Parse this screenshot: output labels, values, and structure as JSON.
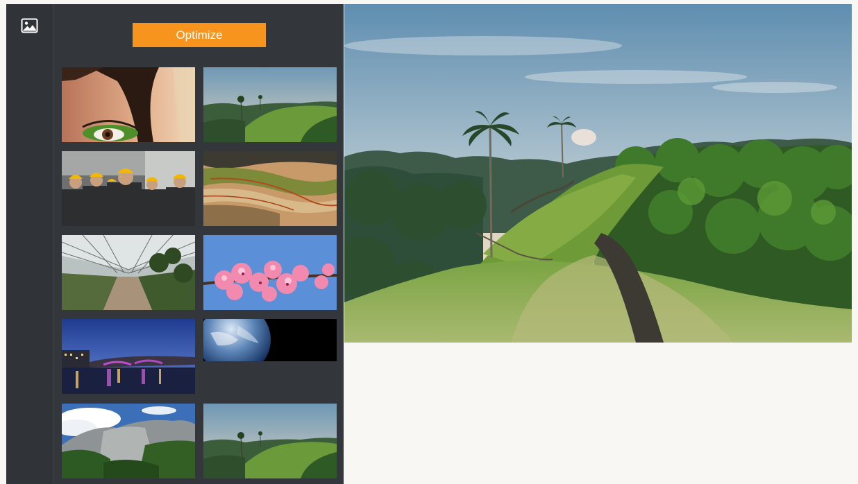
{
  "sidebar": {
    "icon": "image-gallery-icon"
  },
  "panel": {
    "optimize_label": "Optimize",
    "accent_color": "#f7941d",
    "thumbnails": [
      {
        "name": "thumb-woman-eye",
        "icon": "photo"
      },
      {
        "name": "thumb-hill-landscape",
        "icon": "photo"
      },
      {
        "name": "thumb-workers-hardhats",
        "icon": "photo"
      },
      {
        "name": "thumb-terraced-terrain",
        "icon": "photo"
      },
      {
        "name": "thumb-greenhouse",
        "icon": "photo"
      },
      {
        "name": "thumb-pink-blossoms",
        "icon": "photo"
      },
      {
        "name": "thumb-city-bridge-night",
        "icon": "photo"
      },
      {
        "name": "thumb-earth-space",
        "icon": "photo"
      },
      {
        "name": "thumb-mountain-cliff",
        "icon": "photo"
      },
      {
        "name": "thumb-hill-landscape-2",
        "icon": "photo"
      }
    ]
  },
  "preview": {
    "subject": "hill-landscape"
  }
}
